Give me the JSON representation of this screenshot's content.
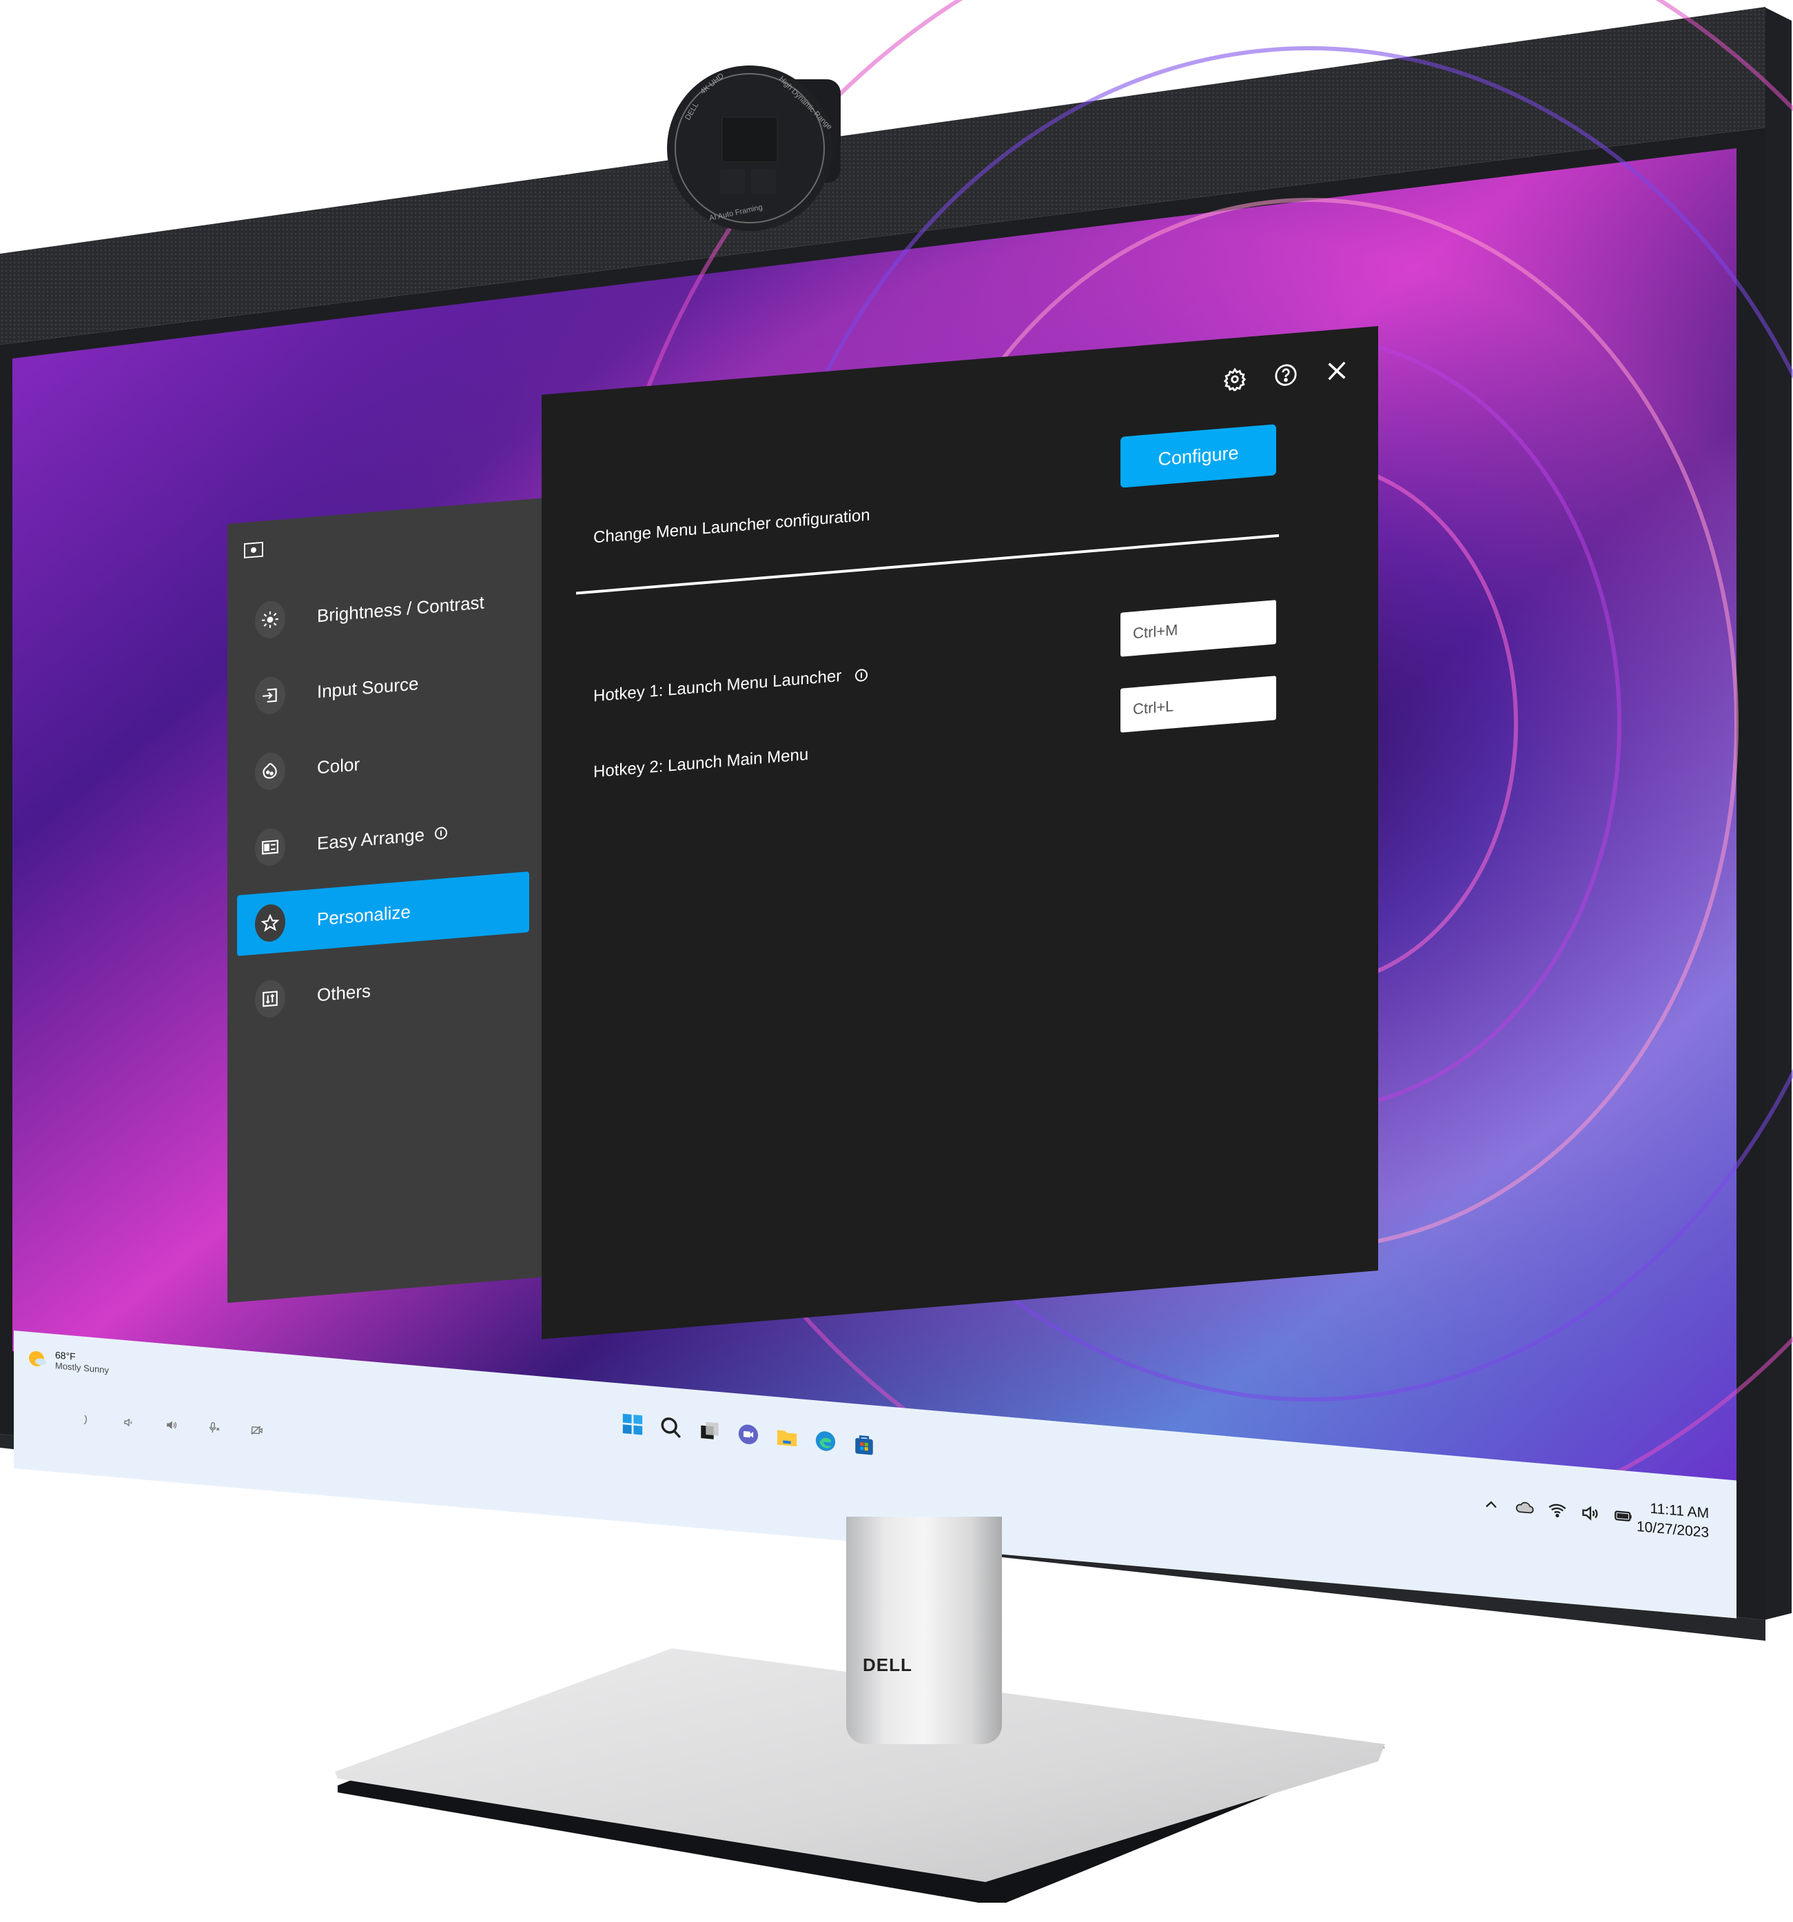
{
  "device": {
    "brand_logo": "DELL",
    "webcam": {
      "labels": [
        "DELL",
        "4K UHD",
        "High Dynamic Range",
        "AI Auto Framing"
      ]
    },
    "bezel_buttons": [
      {
        "icon": "phone-icon"
      },
      {
        "icon": "volume-down-icon"
      },
      {
        "icon": "volume-up-icon"
      },
      {
        "icon": "mic-mute-icon"
      },
      {
        "icon": "camera-off-icon"
      }
    ]
  },
  "osd": {
    "top_icons": [
      {
        "icon": "gear-icon",
        "label": "Settings"
      },
      {
        "icon": "help-icon",
        "label": "Help"
      },
      {
        "icon": "close-icon",
        "label": "Close"
      }
    ],
    "sidebar": {
      "header_icon": "monitor-settings-icon",
      "items": [
        {
          "label": "Brightness / Contrast",
          "icon": "brightness-icon",
          "active": false,
          "info": false
        },
        {
          "label": "Input Source",
          "icon": "input-source-icon",
          "active": false,
          "info": false
        },
        {
          "label": "Color",
          "icon": "color-palette-icon",
          "active": false,
          "info": false
        },
        {
          "label": "Easy Arrange",
          "icon": "easy-arrange-icon",
          "active": false,
          "info": true
        },
        {
          "label": "Personalize",
          "icon": "star-icon",
          "active": true,
          "info": false
        },
        {
          "label": "Others",
          "icon": "others-icon",
          "active": false,
          "info": false
        }
      ]
    },
    "main": {
      "launcher_label": "Change Menu Launcher configuration",
      "configure_button": "Configure",
      "hotkeys": [
        {
          "label": "Hotkey 1: Launch Menu Launcher",
          "value": "Ctrl+M",
          "info": true
        },
        {
          "label": "Hotkey 2: Launch Main Menu",
          "value": "Ctrl+L",
          "info": false
        }
      ]
    },
    "colors": {
      "accent": "#03a1f0",
      "sidebar_bg": "#3d3d3d",
      "main_bg": "#1e1e1e"
    }
  },
  "taskbar": {
    "weather": {
      "temp": "68°F",
      "desc": "Mostly Sunny"
    },
    "apps": [
      {
        "name": "Start",
        "icon": "windows-start-icon"
      },
      {
        "name": "Search",
        "icon": "search-icon"
      },
      {
        "name": "Task View",
        "icon": "task-view-icon"
      },
      {
        "name": "Teams Chat",
        "icon": "teams-chat-icon"
      },
      {
        "name": "File Explorer",
        "icon": "folder-icon"
      },
      {
        "name": "Edge",
        "icon": "edge-browser-icon"
      },
      {
        "name": "Microsoft Store",
        "icon": "store-icon"
      }
    ],
    "tray": [
      {
        "icon": "chevron-up-icon"
      },
      {
        "icon": "onedrive-cloud-icon"
      },
      {
        "icon": "wifi-icon"
      },
      {
        "icon": "speaker-icon"
      },
      {
        "icon": "battery-icon"
      }
    ],
    "time": "11:11 AM",
    "date": "10/27/2023"
  }
}
